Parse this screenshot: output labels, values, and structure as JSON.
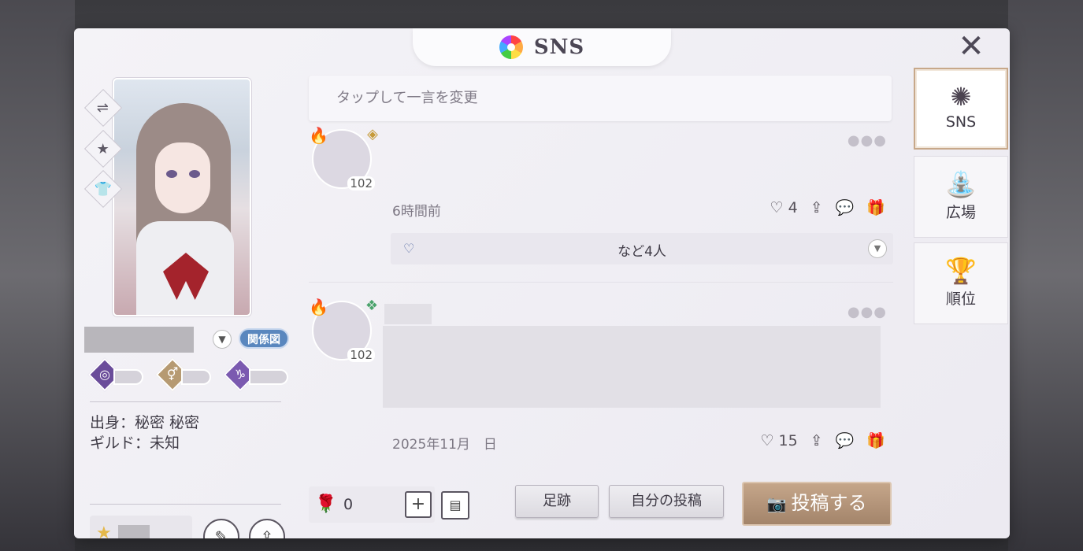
{
  "window": {
    "title": "SNS",
    "close_label": "✕"
  },
  "profile": {
    "side_buttons": [
      "⇌",
      "★",
      "👕"
    ],
    "relationship_label": "関係図",
    "origin_line": "出身：秘密 秘密",
    "guild_line": "ギルド：未知",
    "stats": [
      {
        "icon": "◎",
        "color": "#6a4c9a"
      },
      {
        "icon": "⚥",
        "color": "#b69a72"
      },
      {
        "icon": "♑",
        "color": "#7b5ab0"
      }
    ]
  },
  "feed": {
    "status_placeholder": "タップして一言を変更",
    "posts": [
      {
        "level": "102",
        "time": "6時間前",
        "likes": "4",
        "likes_summary": "など4人"
      },
      {
        "level": "102",
        "time": "2025年11月　日",
        "likes": "15"
      }
    ]
  },
  "bottom_bar": {
    "rose_count": "0",
    "footprint_label": "足跡",
    "my_posts_label": "自分の投稿",
    "post_label": "投稿する"
  },
  "right_tabs": [
    {
      "icon": "sns-icon",
      "label": "SNS",
      "active": true
    },
    {
      "icon": "fountain-icon",
      "label": "広場",
      "active": false
    },
    {
      "icon": "trophy-icon",
      "label": "順位",
      "active": false
    }
  ]
}
